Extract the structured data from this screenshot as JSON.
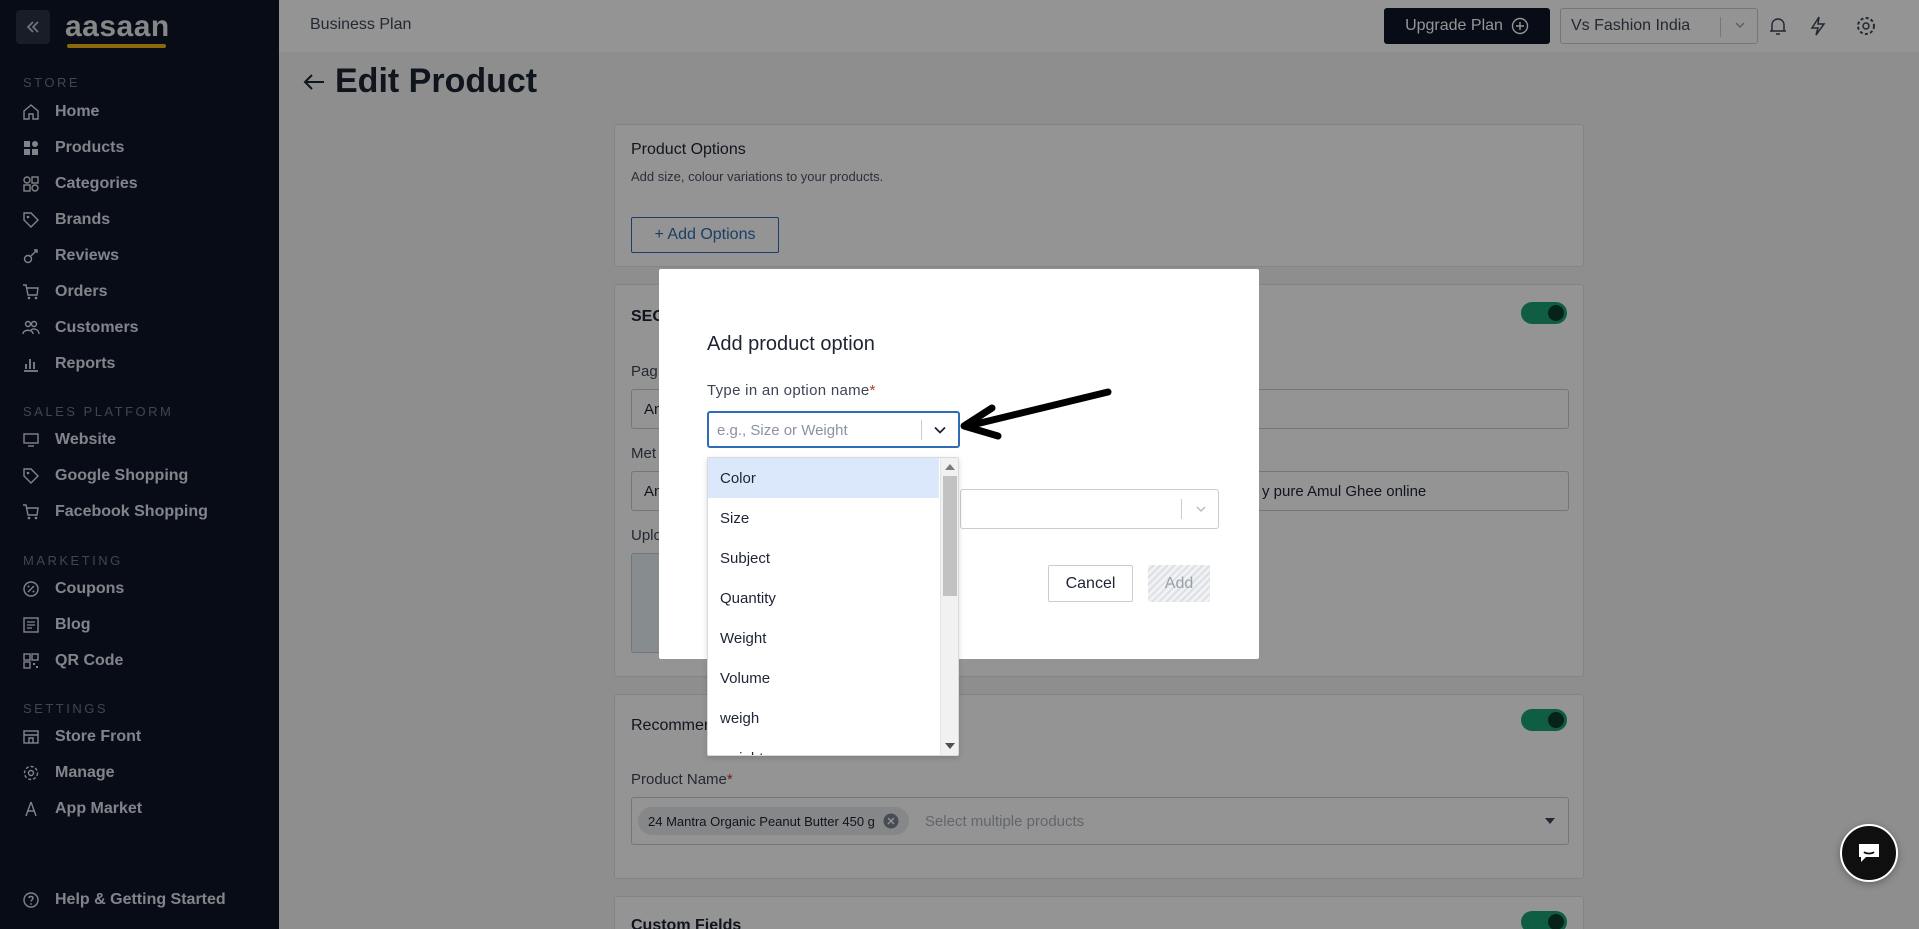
{
  "app": {
    "logo": "aasaan"
  },
  "sidebar": {
    "sections": [
      {
        "label": "STORE",
        "items": [
          {
            "label": "Home",
            "icon": "home-icon"
          },
          {
            "label": "Products",
            "icon": "grid-icon"
          },
          {
            "label": "Categories",
            "icon": "categories-icon"
          },
          {
            "label": "Brands",
            "icon": "tag-icon"
          },
          {
            "label": "Reviews",
            "icon": "reviews-icon"
          },
          {
            "label": "Orders",
            "icon": "cart-icon"
          },
          {
            "label": "Customers",
            "icon": "users-icon"
          },
          {
            "label": "Reports",
            "icon": "bar-chart-icon"
          }
        ]
      },
      {
        "label": "SALES PLATFORM",
        "items": [
          {
            "label": "Website",
            "icon": "monitor-icon"
          },
          {
            "label": "Google Shopping",
            "icon": "tag-icon"
          },
          {
            "label": "Facebook Shopping",
            "icon": "cart-icon"
          }
        ]
      },
      {
        "label": "MARKETING",
        "items": [
          {
            "label": "Coupons",
            "icon": "coupon-icon"
          },
          {
            "label": "Blog",
            "icon": "blog-icon"
          },
          {
            "label": "QR Code",
            "icon": "qr-icon"
          }
        ]
      },
      {
        "label": "SETTINGS",
        "items": [
          {
            "label": "Store Front",
            "icon": "storefront-icon"
          },
          {
            "label": "Manage",
            "icon": "gear-icon"
          },
          {
            "label": "App Market",
            "icon": "app-market-icon"
          }
        ]
      }
    ],
    "help": "Help & Getting Started"
  },
  "header": {
    "plan": "Business Plan",
    "upgrade_label": "Upgrade Plan",
    "store_name": "Vs Fashion India"
  },
  "page": {
    "title": "Edit Product",
    "product_options": {
      "title": "Product Options",
      "subtitle": "Add size, colour variations to your products.",
      "add_button": "+ Add Options"
    },
    "seo": {
      "title_partial": "SEO",
      "page_label_partial": "Pag",
      "page_value_partial": "An",
      "meta_label_partial": "Met",
      "meta_value_partial": "An",
      "meta_value_tail": "y pure Amul Ghee online",
      "upload_label_partial": "Uplo"
    },
    "recommended": {
      "title_partial": "Recommen",
      "product_name_label": "Product Name",
      "selected_chip": "24 Mantra Organic Peanut Butter 450 g",
      "placeholder": "Select multiple products"
    },
    "custom_fields": {
      "title": "Custom Fields"
    }
  },
  "modal": {
    "title": "Add product option",
    "option_label": "Type in an option name",
    "option_placeholder": "e.g., Size or Weight",
    "cancel_label": "Cancel",
    "add_label": "Add",
    "options": [
      "Color",
      "Size",
      "Subject",
      "Quantity",
      "Weight",
      "Volume",
      "weigh",
      "weight"
    ]
  },
  "colors": {
    "sidebar_bg": "#0f1628",
    "accent": "#2f6cb5",
    "toggle_on": "#1aa374",
    "logo_swoosh": "#f2b417"
  }
}
